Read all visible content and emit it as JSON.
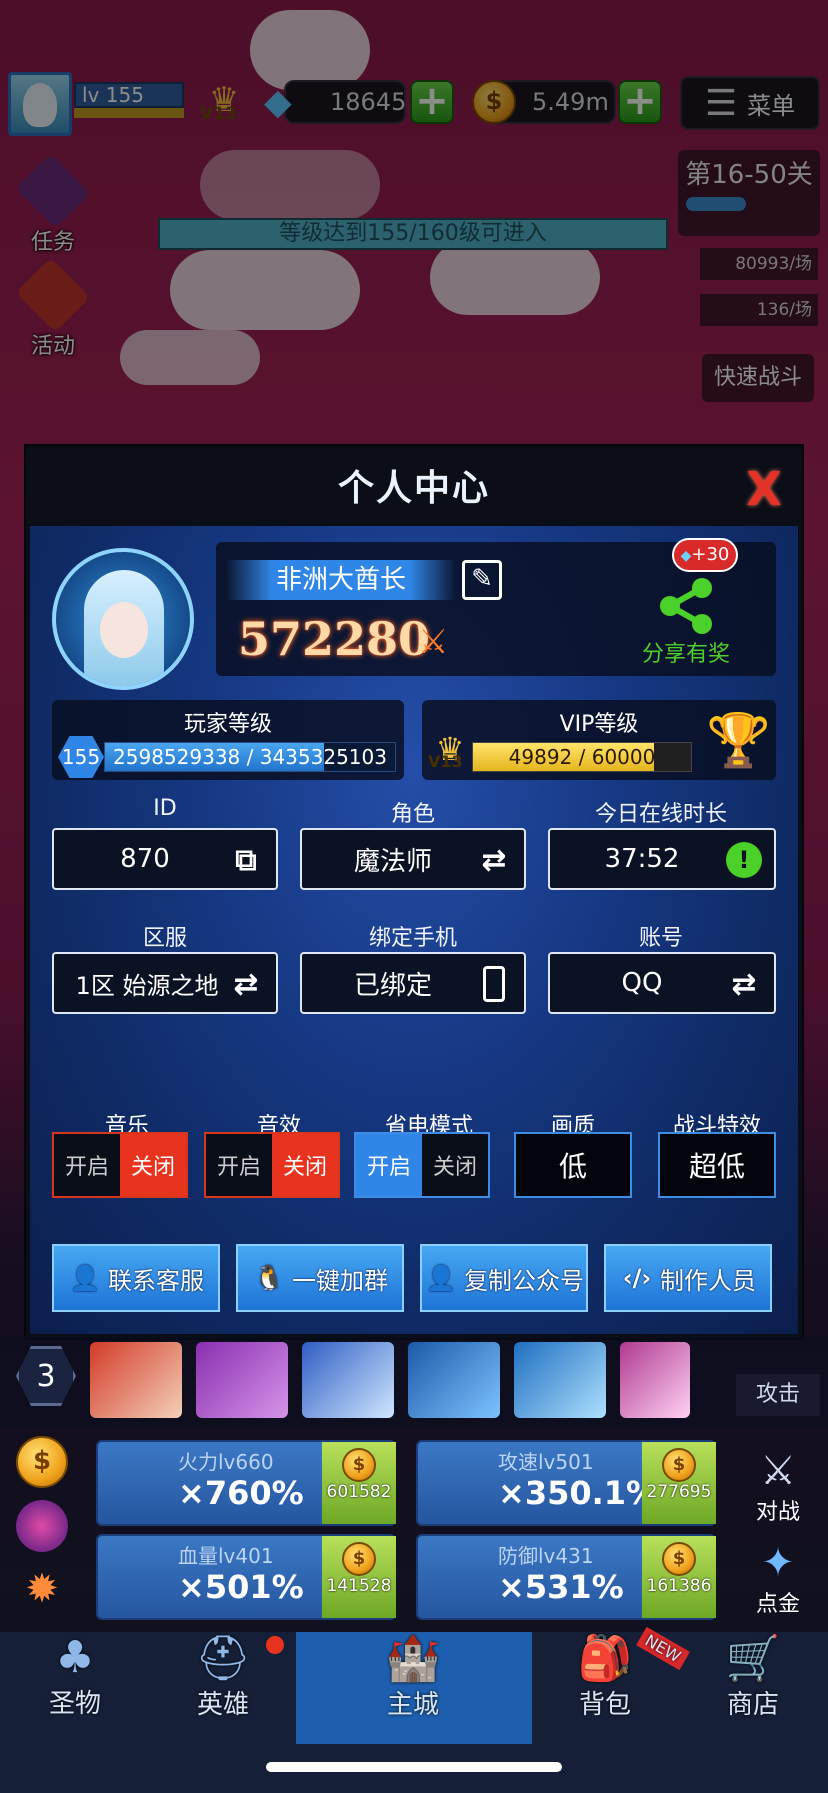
{
  "hud": {
    "level": "lv 155",
    "vip": "V13",
    "gems": "18645",
    "gold": "5.49m",
    "menu_label": "菜单",
    "stage": "第16-50关",
    "exp_rate": "80993/场",
    "gold_rate": "136/场",
    "quick_battle": "快速战斗",
    "level_req": "等级达到155/160级可进入"
  },
  "side": {
    "task": "任务",
    "event": "活动"
  },
  "modal": {
    "title": "个人中心",
    "close": "X",
    "name": "非洲大酋长",
    "power": "572280",
    "share_label": "分享有奖",
    "share_bonus": "+30",
    "player_level_label": "玩家等级",
    "player_level": "155",
    "player_exp": "2598529338 / 3435325103",
    "player_exp_ratio": 0.756,
    "vip_label": "VIP等级",
    "vip_level": "V13",
    "vip_exp": "49892 / 60000",
    "vip_exp_ratio": 0.832,
    "fields": {
      "id_label": "ID",
      "id_value": "870",
      "role_label": "角色",
      "role_value": "魔法师",
      "online_label": "今日在线时长",
      "online_value": "37:52",
      "server_label": "区服",
      "server_value": "1区 始源之地",
      "phone_label": "绑定手机",
      "phone_value": "已绑定",
      "account_label": "账号",
      "account_value": "QQ"
    },
    "options": {
      "music_label": "音乐",
      "sfx_label": "音效",
      "power_label": "省电模式",
      "quality_label": "画质",
      "effects_label": "战斗特效",
      "on": "开启",
      "off": "关闭",
      "quality_value": "低",
      "effects_value": "超低"
    },
    "actions": {
      "support": "联系客服",
      "group": "一键加群",
      "copy_account": "复制公众号",
      "credits": "制作人员"
    }
  },
  "bottom": {
    "skill_count": "3",
    "fire_label": "火力lv660",
    "fire_value": "×760%",
    "fire_cost": "601582",
    "speed_label": "攻速lv501",
    "speed_value": "×350.1%",
    "speed_cost": "277695",
    "hp_label": "血量lv401",
    "hp_value": "×501%",
    "hp_cost": "141528",
    "def_label": "防御lv431",
    "def_value": "×531%",
    "def_cost": "161386",
    "battle": "对战",
    "alchemy": "点金",
    "attack": "攻击",
    "tabs": [
      "圣物",
      "英雄",
      "主城",
      "背包",
      "商店"
    ],
    "new_badge": "NEW"
  },
  "colors": {
    "accent_blue": "#2f86e6",
    "toggle_red": "#e8341f",
    "gold": "#f3c33b",
    "green": "#4cd02a"
  }
}
